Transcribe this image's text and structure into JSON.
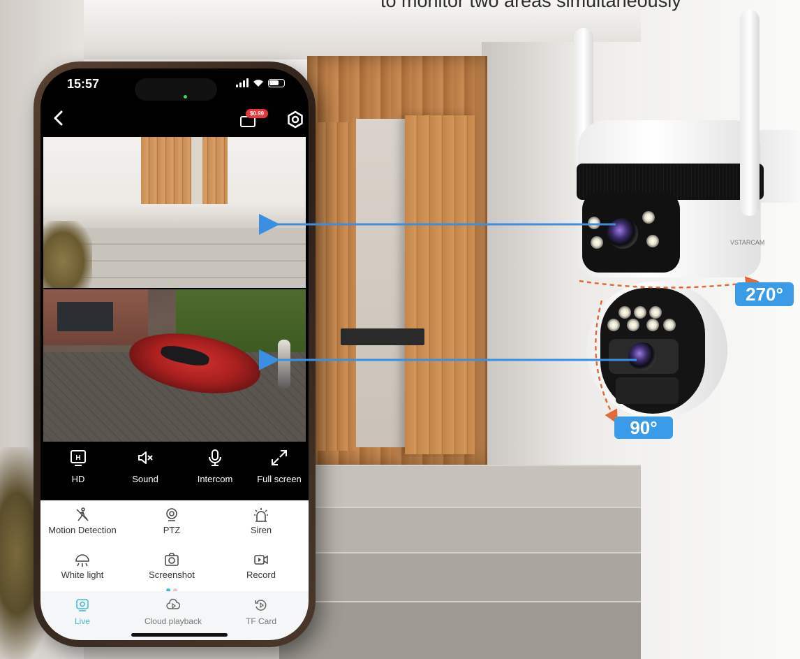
{
  "headline": "to monitor two areas simultaneously",
  "phone": {
    "status_time": "15:57",
    "coupon_price": "$0.99",
    "controls": [
      {
        "icon": "hd-icon",
        "label": "HD"
      },
      {
        "icon": "sound-muted-icon",
        "label": "Sound"
      },
      {
        "icon": "microphone-icon",
        "label": "Intercom"
      },
      {
        "icon": "fullscreen-icon",
        "label": "Full screen"
      }
    ],
    "functions": [
      {
        "icon": "motion-detection-icon",
        "label": "Motion Detection"
      },
      {
        "icon": "ptz-icon",
        "label": "PTZ"
      },
      {
        "icon": "siren-icon",
        "label": "Siren"
      },
      {
        "icon": "white-light-icon",
        "label": "White light"
      },
      {
        "icon": "screenshot-icon",
        "label": "Screenshot"
      },
      {
        "icon": "record-icon",
        "label": "Record"
      }
    ],
    "tabs": [
      {
        "icon": "live-icon",
        "label": "Live",
        "active": true
      },
      {
        "icon": "cloud-playback-icon",
        "label": "Cloud playback",
        "active": false
      },
      {
        "icon": "tf-card-icon",
        "label": "TF Card",
        "active": false
      }
    ],
    "accent_color": "#3ab8d6"
  },
  "camera": {
    "brand": "VSTARCAM",
    "rotation_horizontal": "270°",
    "rotation_vertical": "90°",
    "badge_color": "#3a9be8"
  }
}
